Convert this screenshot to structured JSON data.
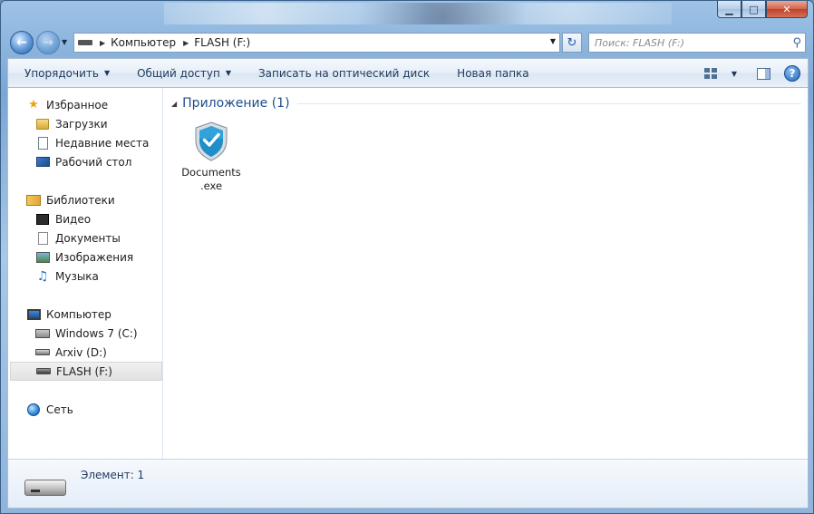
{
  "window": {
    "caption_buttons": {
      "minimize": "▁",
      "maximize": "□",
      "close": "✕"
    }
  },
  "nav": {
    "back_icon": "back-arrow-icon",
    "forward_icon": "forward-arrow-icon",
    "address": {
      "crumbs": [
        "Компьютер",
        "FLASH (F:)"
      ]
    },
    "search_placeholder": "Поиск: FLASH (F:)"
  },
  "toolbar": {
    "organize": "Упорядочить",
    "share": "Общий доступ",
    "burn": "Записать на оптический диск",
    "new_folder": "Новая папка",
    "help": "?"
  },
  "sidebar": {
    "favorites": {
      "label": "Избранное",
      "items": [
        {
          "label": "Загрузки",
          "icon": "downloads-folder-icon"
        },
        {
          "label": "Недавние места",
          "icon": "recent-places-icon"
        },
        {
          "label": "Рабочий стол",
          "icon": "desktop-icon"
        }
      ]
    },
    "libraries": {
      "label": "Библиотеки",
      "items": [
        {
          "label": "Видео",
          "icon": "video-library-icon"
        },
        {
          "label": "Документы",
          "icon": "documents-library-icon"
        },
        {
          "label": "Изображения",
          "icon": "pictures-library-icon"
        },
        {
          "label": "Музыка",
          "icon": "music-library-icon"
        }
      ]
    },
    "computer": {
      "label": "Компьютер",
      "items": [
        {
          "label": "Windows 7 (C:)",
          "icon": "system-drive-icon"
        },
        {
          "label": "Arxiv (D:)",
          "icon": "hard-drive-icon"
        },
        {
          "label": "FLASH (F:)",
          "icon": "removable-drive-icon",
          "selected": true
        }
      ]
    },
    "network": {
      "label": "Сеть"
    }
  },
  "main": {
    "group_title": "Приложение (1)",
    "files": [
      {
        "name_line1": "Documents",
        "name_line2": ".exe",
        "icon": "shield-app-icon"
      }
    ]
  },
  "details": {
    "text": "Элемент: 1",
    "icon": "removable-drive-icon"
  },
  "colors": {
    "accent": "#1e4e8c",
    "shield": "#1f8ec9",
    "window_frame": "#7aa6d4"
  }
}
